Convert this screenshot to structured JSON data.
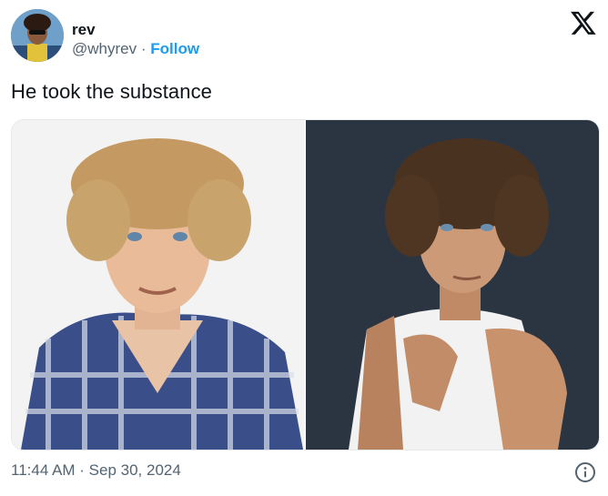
{
  "author": {
    "display_name": "rev",
    "handle": "@whyrev",
    "separator": "·",
    "follow_label": "Follow"
  },
  "tweet": {
    "text": "He took the substance",
    "timestamp": "11:44 AM · Sep 30, 2024"
  },
  "icons": {
    "brand": "x-logo-icon",
    "info": "info-icon"
  },
  "colors": {
    "text": "#0f1419",
    "secondary": "#536471",
    "link": "#1d9bf0"
  }
}
